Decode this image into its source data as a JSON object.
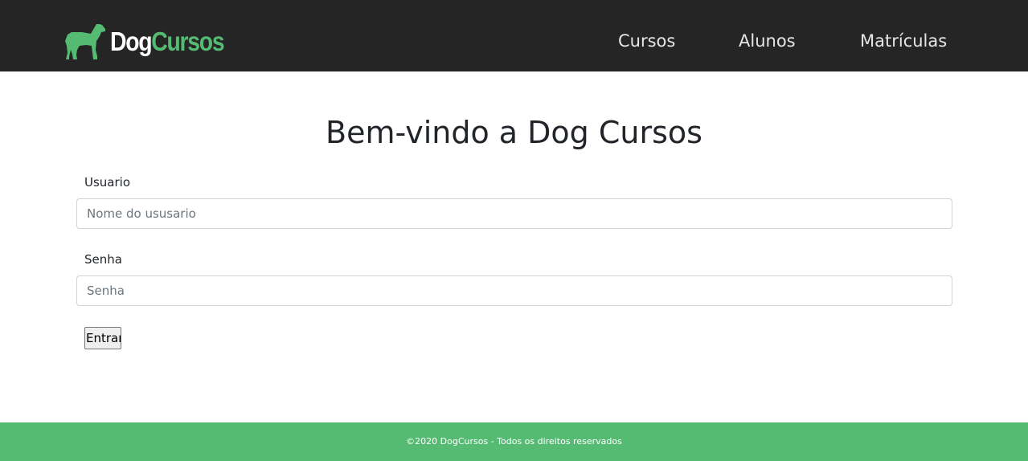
{
  "header": {
    "brand": {
      "part1": "Dog",
      "part2": "Cursos",
      "icon": "dog-logo-icon"
    },
    "nav": [
      {
        "label": "Cursos"
      },
      {
        "label": "Alunos"
      },
      {
        "label": "Matrículas"
      }
    ]
  },
  "main": {
    "title": "Bem-vindo a Dog Cursos",
    "username": {
      "label": "Usuario",
      "placeholder": "Nome do ususario",
      "value": ""
    },
    "password": {
      "label": "Senha",
      "placeholder": "Senha",
      "value": ""
    },
    "submit_label": "Entrar"
  },
  "footer": {
    "text": "©2020 DogCursos - Todos os direitos reservados"
  },
  "colors": {
    "navbar": "#252525",
    "accent": "#55bb73",
    "nav_text": "#e6e6e6"
  }
}
